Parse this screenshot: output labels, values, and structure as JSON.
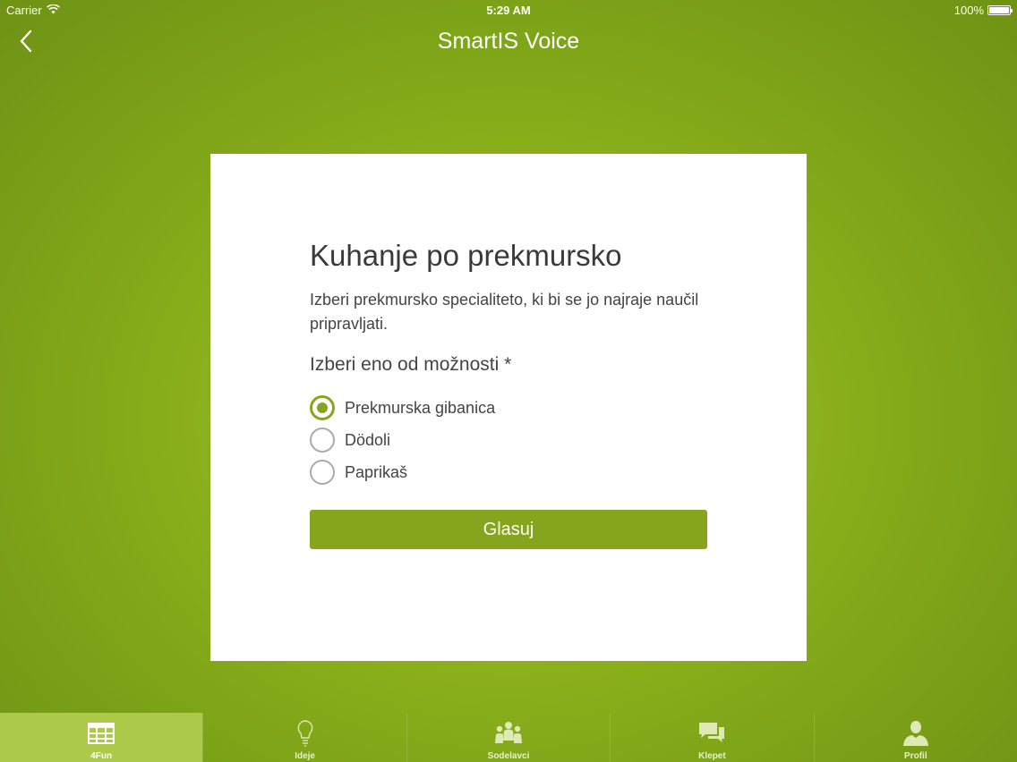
{
  "status_bar": {
    "carrier": "Carrier",
    "time": "5:29 AM",
    "battery": "100%"
  },
  "nav": {
    "title": "SmartIS Voice"
  },
  "poll": {
    "title": "Kuhanje po prekmursko",
    "description": "Izberi prekmursko specialiteto, ki bi se jo najraje naučil pripravljati.",
    "question": "Izberi eno od možnosti *",
    "options": [
      {
        "label": "Prekmurska gibanica",
        "selected": true
      },
      {
        "label": "Dödoli",
        "selected": false
      },
      {
        "label": "Paprikaš",
        "selected": false
      }
    ],
    "vote_label": "Glasuj"
  },
  "tabs": [
    {
      "label": "4Fun",
      "icon": "table-icon",
      "active": true
    },
    {
      "label": "Ideje",
      "icon": "lightbulb-icon",
      "active": false
    },
    {
      "label": "Sodelavci",
      "icon": "people-icon",
      "active": false
    },
    {
      "label": "Klepet",
      "icon": "chat-icon",
      "active": false
    },
    {
      "label": "Profil",
      "icon": "person-icon",
      "active": false
    }
  ],
  "colors": {
    "accent": "#86a51c",
    "active_tab": "#acc94a",
    "background": "#8fb41c"
  }
}
